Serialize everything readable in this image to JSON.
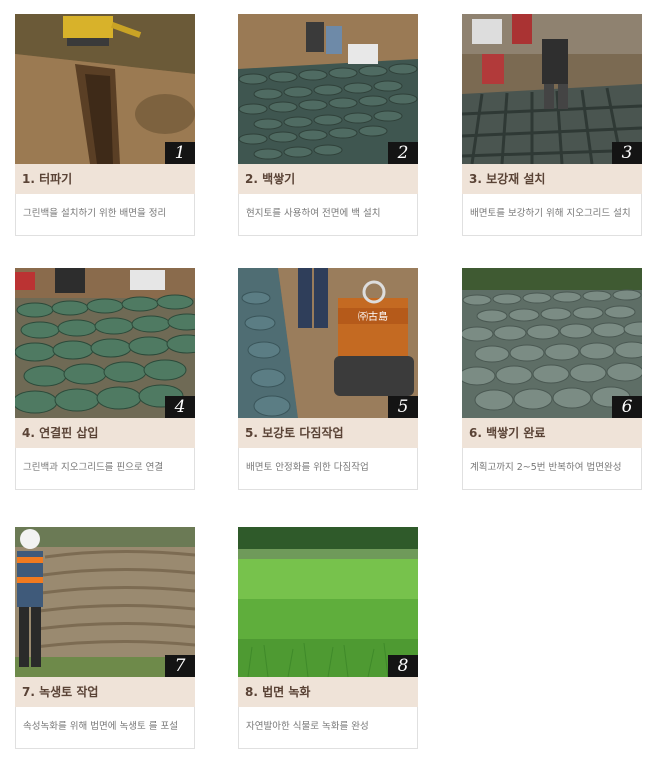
{
  "steps": [
    {
      "num": "1",
      "title": "1. 터파기",
      "desc": "그린백을 설치하기 위한 배면을 정리"
    },
    {
      "num": "2",
      "title": "2. 백쌓기",
      "desc": "현지토를 사용하여 전면에 백 설치"
    },
    {
      "num": "3",
      "title": "3. 보강재 설치",
      "desc": "배면토를 보강하기 위해 지오그리드 설치"
    },
    {
      "num": "4",
      "title": "4. 연결핀 삽입",
      "desc": "그린백과 지오그리드를 핀으로 연결"
    },
    {
      "num": "5",
      "title": "5. 보강토 다짐작업",
      "desc": "배면토 안정화를 위한 다짐작업"
    },
    {
      "num": "6",
      "title": "6. 백쌓기 완료",
      "desc": "계획고까지 2~5번 반복하여 법면완성"
    },
    {
      "num": "7",
      "title": "7. 녹생토 작업",
      "desc": "속성녹화를 위해 법면에 녹생토 를 포설"
    },
    {
      "num": "8",
      "title": "8. 법면 녹화",
      "desc": "자연발아한 식물로 녹화를 완성"
    }
  ],
  "roller_label": "㈜古島"
}
